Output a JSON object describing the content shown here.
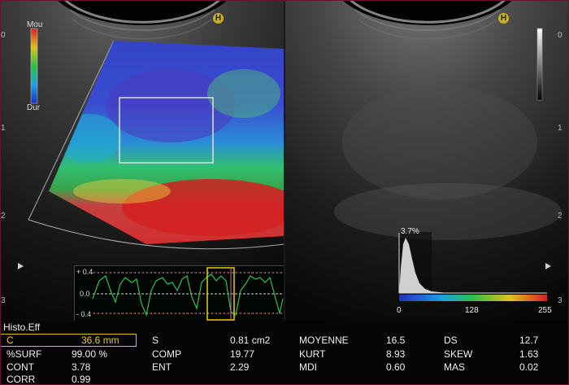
{
  "left_panel": {
    "scale_top_label": "Mou",
    "scale_bottom_label": "Dur",
    "hold_icon": "H",
    "depth_ticks": [
      "0",
      "1",
      "2",
      "3"
    ],
    "strain_graph": {
      "y_ticks": [
        "+ 0.4",
        "0.0",
        "- 0.4"
      ]
    }
  },
  "right_panel": {
    "hold_icon": "H",
    "depth_ticks": [
      "0",
      "1",
      "2",
      "3"
    ],
    "histogram": {
      "peak_label": "3.7%",
      "scale_min": "0",
      "scale_mid": "128",
      "scale_max": "255"
    }
  },
  "measurements": {
    "title": "Histo.Eff",
    "rows": [
      [
        {
          "label": "C",
          "value": "36.6 mm"
        },
        {
          "label": "S",
          "value": "0.81 cm2"
        },
        {
          "label": "MOYENNE",
          "value": "16.5"
        },
        {
          "label": "DS",
          "value": "12.7"
        }
      ],
      [
        {
          "label": "%SURF",
          "value": "99.00 %"
        },
        {
          "label": "COMP",
          "value": "19.77"
        },
        {
          "label": "KURT",
          "value": "8.93"
        },
        {
          "label": "SKEW",
          "value": "1.63"
        }
      ],
      [
        {
          "label": "CONT",
          "value": "3.78"
        },
        {
          "label": "ENT",
          "value": "2.29"
        },
        {
          "label": "MDI",
          "value": "0.60"
        },
        {
          "label": "MAS",
          "value": "0.02"
        }
      ],
      [
        {
          "label": "CORR",
          "value": "0.99"
        }
      ]
    ]
  },
  "colors": {
    "highlight": "#e6d300",
    "elastography_soft": "#d93030",
    "elastography_hard": "#2a3cc8",
    "graph_line": "#2fc24a"
  }
}
